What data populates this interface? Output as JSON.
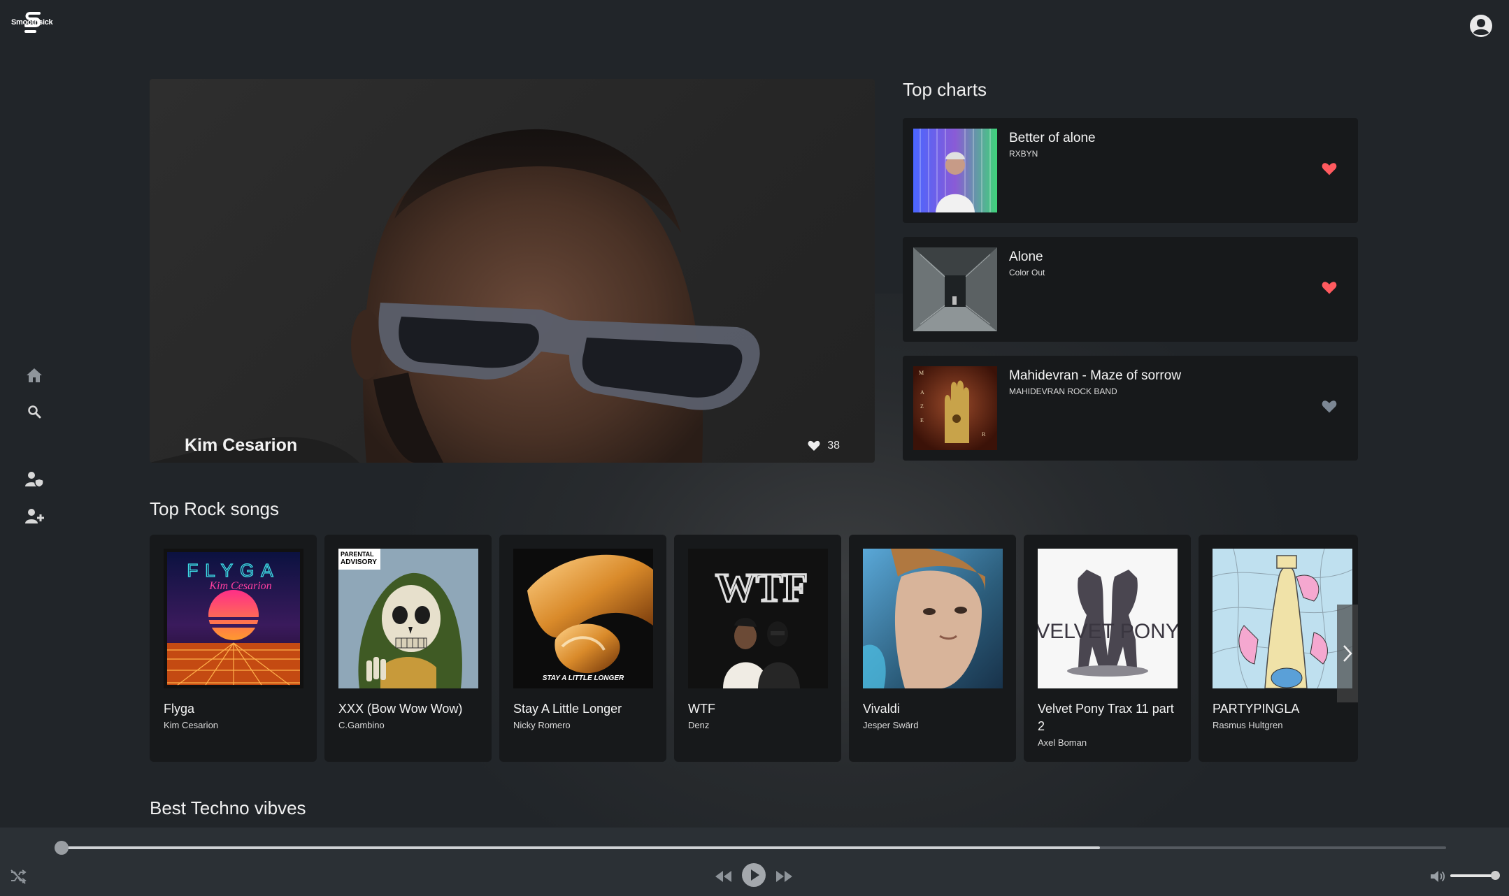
{
  "app": {
    "logo_text": "Smoothsick"
  },
  "hero": {
    "artist": "Kim Cesarion",
    "likes": "38"
  },
  "top_charts": {
    "title": "Top charts",
    "items": [
      {
        "title": "Better of alone",
        "artist": "RXBYN",
        "liked": true
      },
      {
        "title": "Alone",
        "artist": "Color Out",
        "liked": true
      },
      {
        "title": "Mahidevran - Maze of sorrow",
        "artist": "MAHIDEVRAN ROCK BAND",
        "liked": false
      }
    ]
  },
  "top_rock": {
    "title": "Top Rock songs",
    "songs": [
      {
        "title": "Flyga",
        "artist": "Kim Cesarion",
        "cover_text": "FLYGA"
      },
      {
        "title": "XXX (Bow Wow Wow)",
        "artist": "C.Gambino",
        "cover_text": "PARENTAL ADVISORY"
      },
      {
        "title": "Stay A Little Longer",
        "artist": "Nicky Romero",
        "cover_text": "STAY A LITTLE LONGER"
      },
      {
        "title": "WTF",
        "artist": "Denz",
        "cover_text": "WTF"
      },
      {
        "title": "Vivaldi",
        "artist": "Jesper Swärd",
        "cover_text": ""
      },
      {
        "title": "Velvet Pony Trax 11 part 2",
        "artist": "Axel Boman",
        "cover_text": "VELVET PONY"
      },
      {
        "title": "PARTYPINGLA",
        "artist": "Rasmus Hultgren",
        "cover_text": ""
      }
    ]
  },
  "best_techno": {
    "title": "Best Techno vibves"
  },
  "player": {
    "progress": 0.0,
    "buffered": 0.75,
    "volume": 0.92
  },
  "colors": {
    "background": "#212529",
    "card": "#17191b",
    "player": "#2b3035",
    "heart_liked": "#ff5a5f",
    "heart_unliked": "#7c8794"
  },
  "icons": {
    "nav": [
      "home-icon",
      "search-icon",
      "user-shield-icon",
      "user-plus-icon"
    ],
    "player": [
      "shuffle-icon",
      "rewind-icon",
      "play-icon",
      "fast-forward-icon",
      "volume-icon"
    ]
  }
}
